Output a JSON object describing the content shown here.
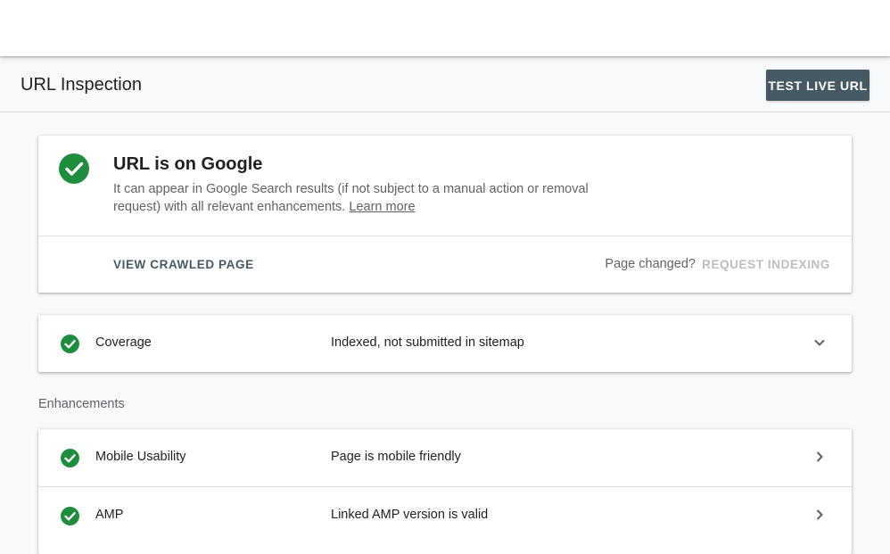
{
  "colors": {
    "accent_dark": "#455a64",
    "success_green": "#1e8e3e",
    "muted_text": "#5f6368",
    "disabled_text": "#bdbdbd"
  },
  "header": {
    "title": "URL Inspection",
    "test_live_url_label": "TEST LIVE URL"
  },
  "status_card": {
    "icon": "check-circle-icon",
    "title": "URL is on Google",
    "description": "It can appear in Google Search results (if not subject to a manual action or removal request) with all relevant enhancements.",
    "learn_more": "Learn more",
    "view_crawled_label": "VIEW CRAWLED PAGE",
    "page_changed": "Page changed?",
    "request_indexing_label": "REQUEST INDEXING"
  },
  "coverage": {
    "icon": "check-circle-icon",
    "label": "Coverage",
    "value": "Indexed, not submitted in sitemap",
    "expand_icon": "chevron-down-icon"
  },
  "enhancements": {
    "heading": "Enhancements",
    "items": [
      {
        "icon": "check-circle-icon",
        "label": "Mobile Usability",
        "value": "Page is mobile friendly",
        "arrow_icon": "chevron-right-icon"
      },
      {
        "icon": "check-circle-icon",
        "label": "AMP",
        "value": "Linked AMP version is valid",
        "arrow_icon": "chevron-right-icon"
      }
    ]
  }
}
